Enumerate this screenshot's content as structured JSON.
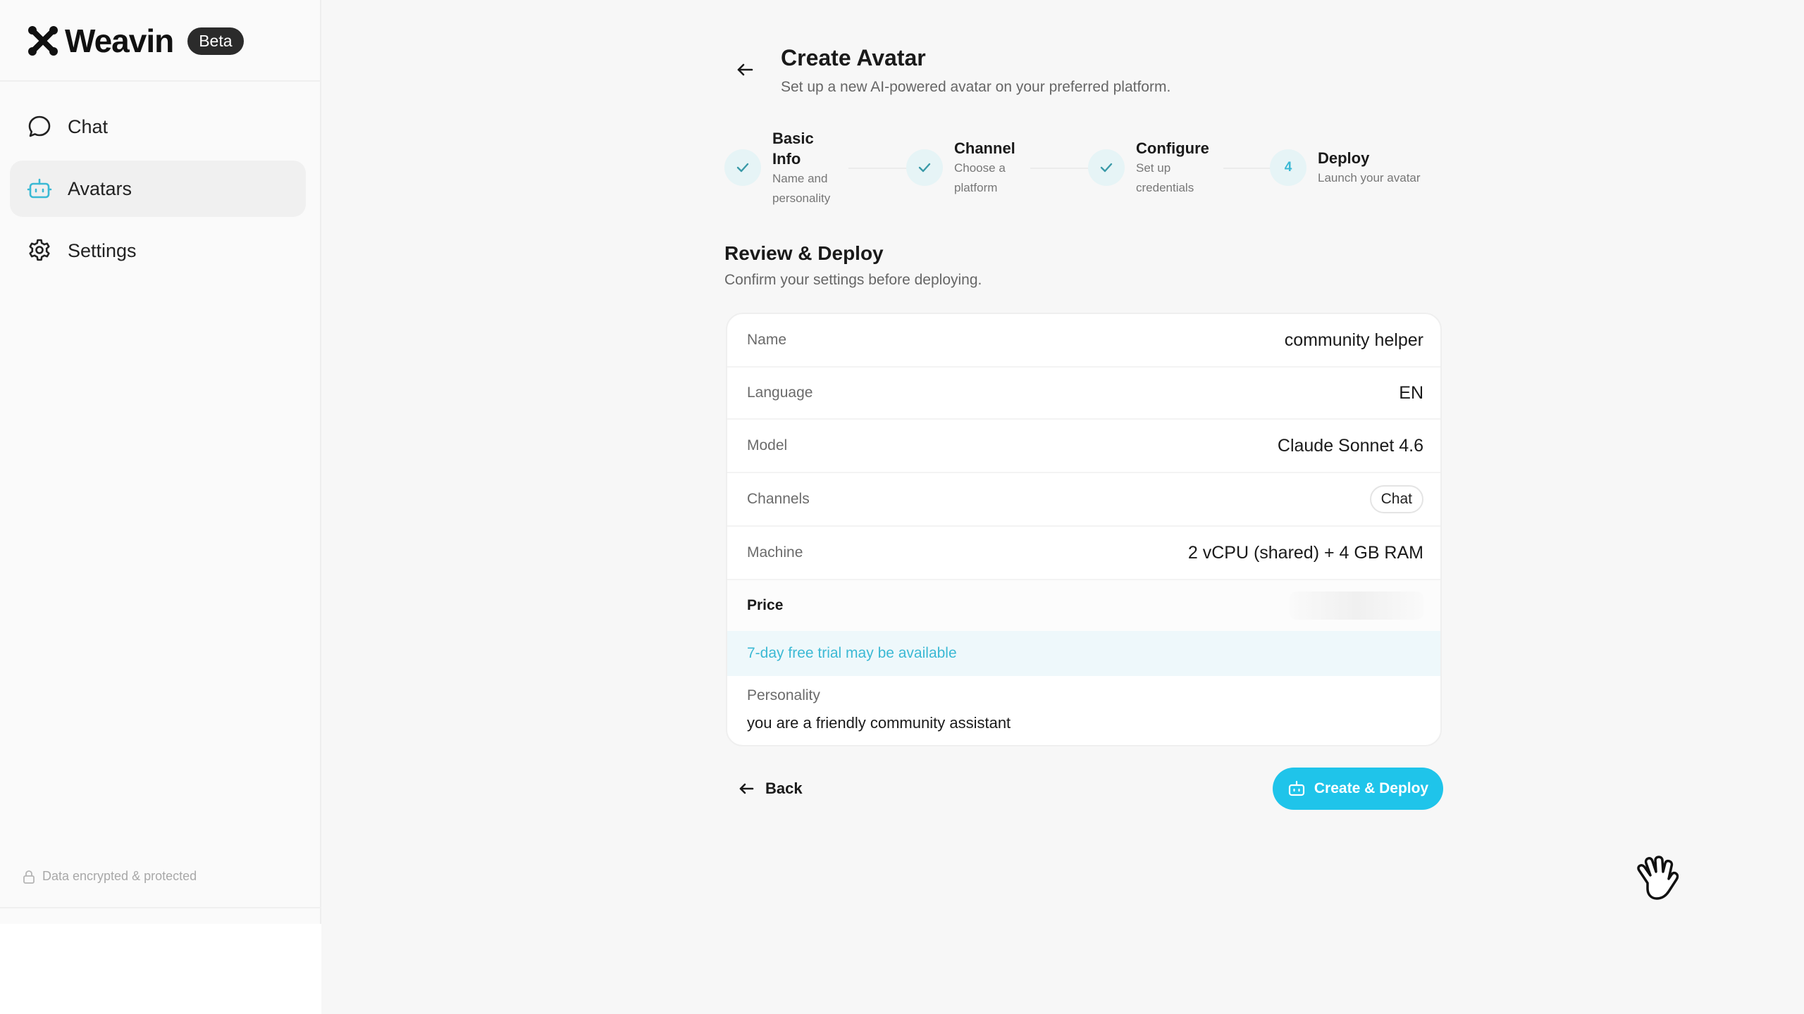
{
  "app": {
    "brand_name": "Weavin",
    "beta_label": "Beta"
  },
  "sidebar": {
    "items": [
      {
        "label": "Chat",
        "icon": "chat-bubble-icon"
      },
      {
        "label": "Avatars",
        "icon": "robot-icon",
        "active": true
      },
      {
        "label": "Settings",
        "icon": "gear-icon"
      }
    ],
    "footer_text": "Data encrypted & protected"
  },
  "header": {
    "title": "Create Avatar",
    "subtitle": "Set up a new AI-powered avatar on your preferred platform."
  },
  "stepper": {
    "steps": [
      {
        "title_line1": "Basic",
        "title_line2": "Info",
        "desc_line1": "Name and",
        "desc_line2": "personality",
        "state": "done"
      },
      {
        "title": "Channel",
        "desc_line1": "Choose a",
        "desc_line2": "platform",
        "state": "done"
      },
      {
        "title": "Configure",
        "desc_line1": "Set up",
        "desc_line2": "credentials",
        "state": "done"
      },
      {
        "number": "4",
        "title": "Deploy",
        "desc": "Launch your avatar",
        "state": "current"
      }
    ]
  },
  "review": {
    "title": "Review & Deploy",
    "subtitle": "Confirm your settings before deploying.",
    "name_label": "Name",
    "name_value": "community helper",
    "language_label": "Language",
    "language_value": "EN",
    "model_label": "Model",
    "model_value": "Claude Sonnet 4.6",
    "channels_label": "Channels",
    "channels_value": "Chat",
    "machine_label": "Machine",
    "machine_value": "2 vCPU (shared) + 4 GB RAM",
    "price_label": "Price",
    "trial_text": "7-day free trial may be available",
    "personality_label": "Personality",
    "personality_value": "you are a friendly community assistant"
  },
  "actions": {
    "back_label": "Back",
    "deploy_label": "Create & Deploy"
  },
  "colors": {
    "accent": "#1fc4ea",
    "accent_text": "#3bb9d4",
    "step_circle_bg": "#e6f4f6"
  }
}
